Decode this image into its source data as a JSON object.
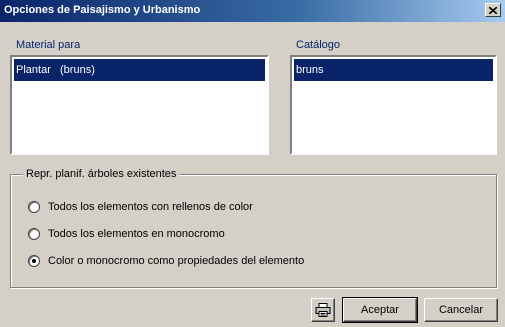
{
  "window": {
    "title": "Opciones de Paisajismo y Urbanismo"
  },
  "material": {
    "label": "Material para",
    "items": [
      {
        "text": "Plantar   (bruns)",
        "selected": true
      }
    ]
  },
  "catalog": {
    "label": "Catálogo",
    "items": [
      {
        "text": "bruns",
        "selected": true
      }
    ]
  },
  "group": {
    "title": "Repr. planif. árboles existentes",
    "options": [
      {
        "label": "Todos los elementos con rellenos de color",
        "checked": false
      },
      {
        "label": "Todos los elementos en monocromo",
        "checked": false
      },
      {
        "label": "Color o monocromo como propiedades del elemento",
        "checked": true
      }
    ]
  },
  "buttons": {
    "print_icon": "printer-icon",
    "accept": "Aceptar",
    "cancel": "Cancelar"
  },
  "colors": {
    "selection": "#0a246a",
    "face": "#d4d0c8"
  }
}
